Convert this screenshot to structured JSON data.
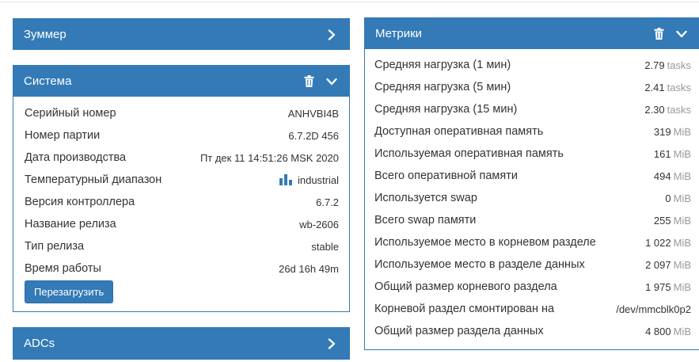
{
  "panels": {
    "zummer": {
      "title": "Зуммер"
    },
    "system": {
      "title": "Система",
      "rows": [
        {
          "label": "Серийный номер",
          "value": "ANHVBI4B"
        },
        {
          "label": "Номер партии",
          "value": "6.7.2D 456"
        },
        {
          "label": "Дата производства",
          "value": "Пт дек 11 14:51:26 MSK 2020"
        },
        {
          "label": "Температурный диапазон",
          "value": "industrial"
        },
        {
          "label": "Версия контроллера",
          "value": "6.7.2"
        },
        {
          "label": "Название релиза",
          "value": "wb-2606"
        },
        {
          "label": "Тип релиза",
          "value": "stable"
        },
        {
          "label": "Время работы",
          "value": "26d 16h 49m"
        }
      ],
      "reboot_label": "Перезагрузить"
    },
    "adcs": {
      "title": "ADCs"
    },
    "metrics": {
      "title": "Метрики",
      "rows": [
        {
          "label": "Средняя нагрузка (1 мин)",
          "value": "2.79",
          "unit": "tasks"
        },
        {
          "label": "Средняя нагрузка (5 мин)",
          "value": "2.41",
          "unit": "tasks"
        },
        {
          "label": "Средняя нагрузка (15 мин)",
          "value": "2.30",
          "unit": "tasks"
        },
        {
          "label": "Доступная оперативная память",
          "value": "319",
          "unit": "MiB"
        },
        {
          "label": "Используемая оперативная память",
          "value": "161",
          "unit": "MiB"
        },
        {
          "label": "Всего оперативной памяти",
          "value": "494",
          "unit": "MiB"
        },
        {
          "label": "Используется swap",
          "value": "0",
          "unit": "MiB"
        },
        {
          "label": "Всего swap памяти",
          "value": "255",
          "unit": "MiB"
        },
        {
          "label": "Используемое место в корневом разделе",
          "value": "1 022",
          "unit": "MiB"
        },
        {
          "label": "Используемое место в разделе данных",
          "value": "2 097",
          "unit": "MiB"
        },
        {
          "label": "Общий размер корневого раздела",
          "value": "1 975",
          "unit": "MiB"
        },
        {
          "label": "Корневой раздел смонтирован на",
          "value": "/dev/mmcblk0p2",
          "unit": ""
        },
        {
          "label": "Общий размер раздела данных",
          "value": "4 800",
          "unit": "MiB"
        }
      ]
    }
  },
  "icons": {
    "chevron_right": "chevron-right-icon",
    "chevron_down": "chevron-down-icon",
    "trash": "trash-icon",
    "bar_chart": "bar-chart-icon"
  },
  "colors": {
    "panel_primary": "#337ab7",
    "unit_gray": "#999999"
  }
}
